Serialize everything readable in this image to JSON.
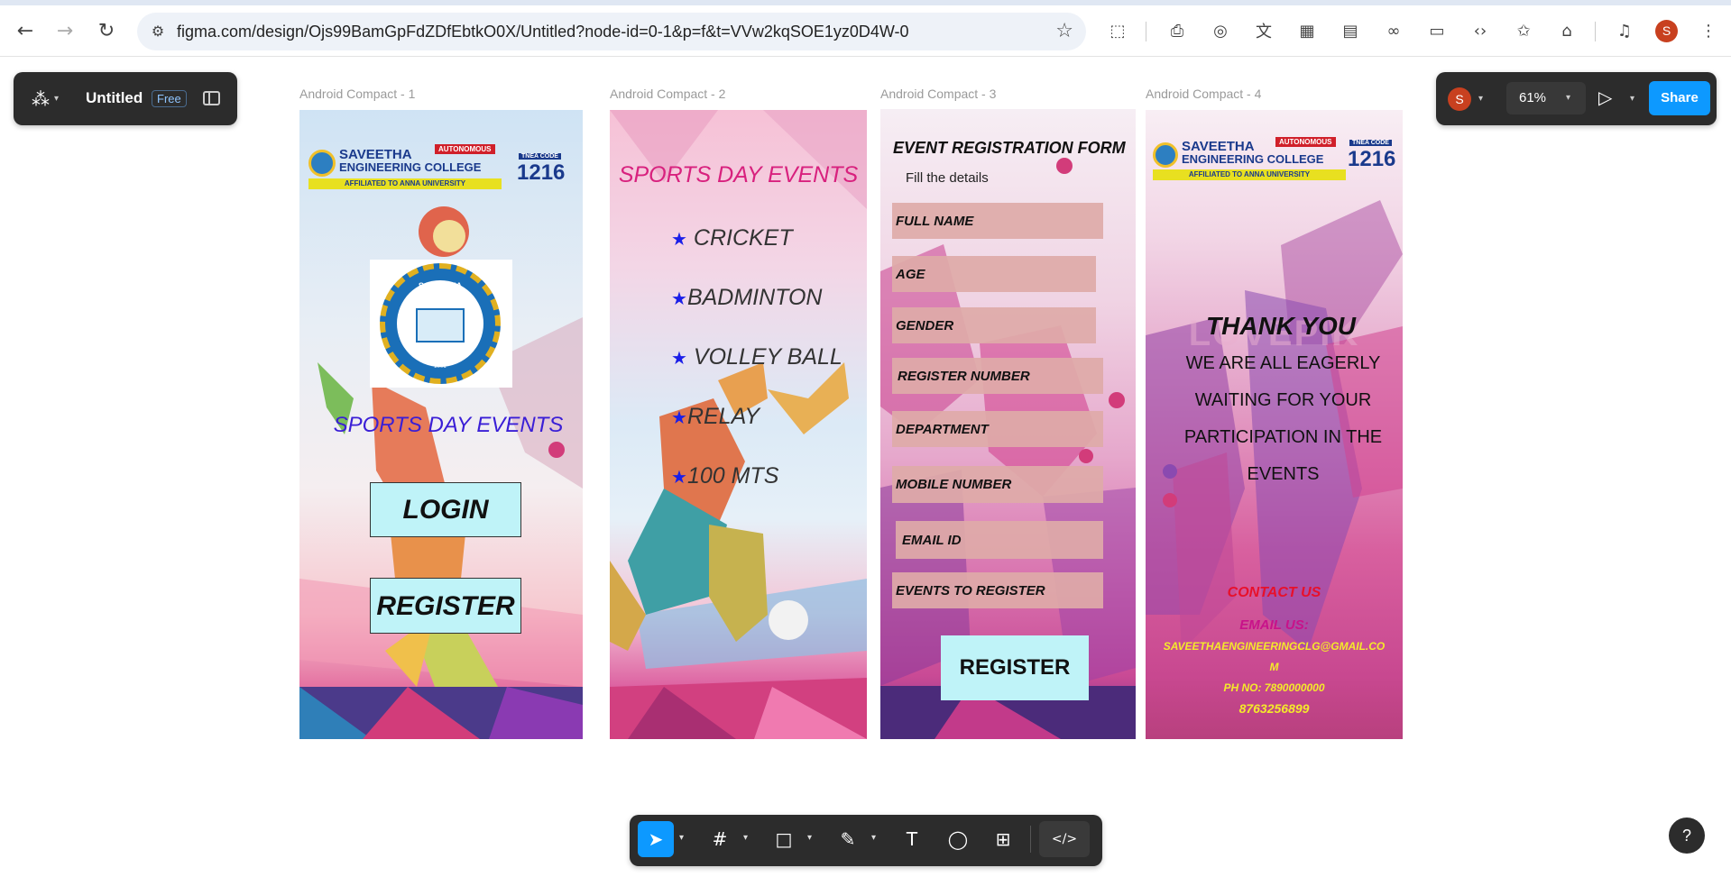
{
  "browser": {
    "url": "figma.com/design/Ojs99BamGpFdZDfEbtkO0X/Untitled?node-id=0-1&p=f&t=VVw2kqSOE1yz0D4W-0",
    "profile_initial": "S"
  },
  "figma": {
    "file_name": "Untitled",
    "plan_badge": "Free",
    "user_initial": "S",
    "zoom": "61%",
    "share_label": "Share",
    "help_label": "?"
  },
  "frames": [
    {
      "label": "Android Compact - 1"
    },
    {
      "label": "Android Compact - 2"
    },
    {
      "label": "Android Compact - 3"
    },
    {
      "label": "Android Compact - 4"
    }
  ],
  "college": {
    "name_line1": "SAVEETHA",
    "name_line2": "ENGINEERING COLLEGE",
    "autonomous": "AUTONOMOUS",
    "affiliation": "AFFILIATED TO ANNA UNIVERSITY",
    "tnea_label": "TNEA CODE",
    "tnea_code": "1216",
    "seal_top": "SAVEETHA",
    "seal_sub": "ENGINEERING COLLEGE",
    "seal_motto": "BE THE BEST",
    "seal_year": "2001"
  },
  "screen1": {
    "title": "SPORTS DAY EVENTS",
    "login": "LOGIN",
    "register": "REGISTER"
  },
  "screen2": {
    "title": "SPORTS DAY EVENTS",
    "star": "★",
    "events": [
      "CRICKET",
      "BADMINTON",
      "VOLLEY BALL",
      "RELAY",
      "100 MTS"
    ]
  },
  "screen3": {
    "title": "EVENT REGISTRATION FORM",
    "subtitle": "Fill the details",
    "fields": [
      "FULL NAME",
      "AGE",
      "GENDER",
      "REGISTER NUMBER",
      "DEPARTMENT",
      "MOBILE NUMBER",
      "EMAIL ID",
      "EVENTS TO REGISTER"
    ],
    "register": "REGISTER"
  },
  "screen4": {
    "thanks": "THANK YOU",
    "message_lines": [
      "WE ARE ALL EAGERLY",
      "WAITING FOR YOUR",
      "PARTICIPATION IN THE",
      "EVENTS"
    ],
    "contact_title": "CONTACT US",
    "email_label": "EMAIL US:",
    "email_line1": "SAVEETHAENGINEERINGCLG@GMAIL.CO",
    "email_line2": "M",
    "phone_line1": "PH NO: 7890000000",
    "phone_line2": "8763256899",
    "watermark": "LOVEPIK"
  },
  "colors": {
    "figma_blue": "#0d99ff",
    "toolbar_dark": "#2c2c2c",
    "button_cyan": "#bff3f8",
    "title_blue": "#3a1ed6",
    "title_pink": "#d8217e",
    "contact_red": "#e8102a",
    "email_yellow": "#f4ea2a"
  }
}
